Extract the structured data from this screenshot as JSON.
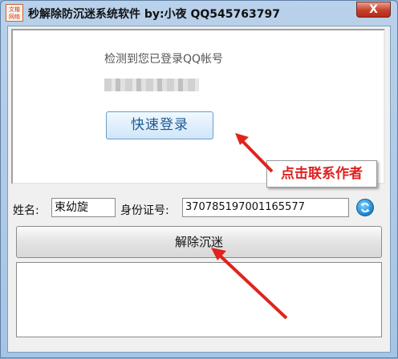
{
  "window": {
    "title": "秒解除防沉迷系统软件 by:小夜    QQ545763797",
    "icon_text": "文楷网络",
    "close_label": "X"
  },
  "login_panel": {
    "detect_text": "检测到您已登录QQ帐号",
    "quick_login_label": "快速登录"
  },
  "annotation": {
    "contact_label": "点击联系作者",
    "arrow_color": "#e0241b"
  },
  "form": {
    "name_label": "姓名:",
    "name_value": "束幼旋",
    "id_label": "身份证号:",
    "id_value": "370785197001165577",
    "refresh_icon": "refresh-icon"
  },
  "actions": {
    "unlock_label": "解除沉迷"
  },
  "log": {
    "text": ""
  }
}
